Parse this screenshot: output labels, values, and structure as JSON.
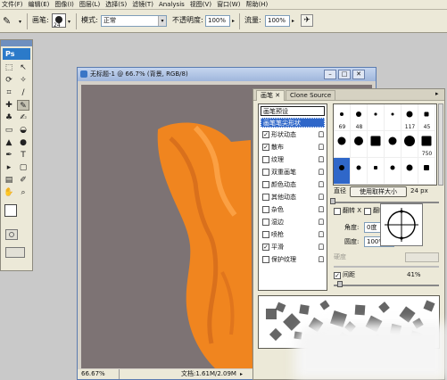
{
  "menubar": {
    "items": [
      "文件(F)",
      "编辑(E)",
      "图像(I)",
      "图层(L)",
      "选择(S)",
      "滤镜(T)",
      "Analysis",
      "视图(V)",
      "窗口(W)",
      "帮助(H)"
    ]
  },
  "options": {
    "brush_label": "画笔:",
    "brush_size": "24",
    "mode_label": "模式:",
    "mode_value": "正常",
    "opacity_label": "不透明度:",
    "opacity_value": "100%",
    "flow_label": "流量:",
    "flow_value": "100%"
  },
  "toolbox": {
    "logo": "Ps"
  },
  "document": {
    "title": "无标题-1 @ 66.7% (背景, RGB/8)",
    "zoom": "66.67%",
    "doc_info": "文档:1.61M/2.09M"
  },
  "panel": {
    "tabs": [
      "画笔",
      "Clone Source"
    ],
    "presets_header": "画笔预设",
    "tip_shape": "画笔笔尖形状",
    "options": [
      {
        "label": "形状动态",
        "checked": true
      },
      {
        "label": "散布",
        "checked": true
      },
      {
        "label": "纹理",
        "checked": false
      },
      {
        "label": "双重画笔",
        "checked": false
      },
      {
        "label": "颜色动态",
        "checked": false
      },
      {
        "label": "其他动态",
        "checked": false
      },
      {
        "label": "杂色",
        "checked": false
      },
      {
        "label": "湿边",
        "checked": false
      },
      {
        "label": "喷枪",
        "checked": false
      },
      {
        "label": "平滑",
        "checked": true
      },
      {
        "label": "保护纹理",
        "checked": false
      }
    ],
    "grid_numbers": [
      "69",
      "48",
      "",
      "",
      "117",
      "45",
      "",
      "",
      "",
      "",
      "",
      "750",
      "",
      "",
      "",
      "",
      "",
      ""
    ],
    "diameter_label": "直径",
    "sample_size_button": "使用取样大小",
    "diameter_value": "24 px",
    "flip_x_label": "翻转 X",
    "flip_y_label": "翻转 Y",
    "angle_label": "角度:",
    "angle_value": "0度",
    "roundness_label": "圆度:",
    "roundness_value": "100%",
    "hardness_label": "硬度",
    "spacing_label": "间距",
    "spacing_checked": true,
    "spacing_value": "41%"
  },
  "colors": {
    "canvas_bg": "#7d7374",
    "fabric": "#f0851f",
    "selection": "#2f67c9"
  }
}
